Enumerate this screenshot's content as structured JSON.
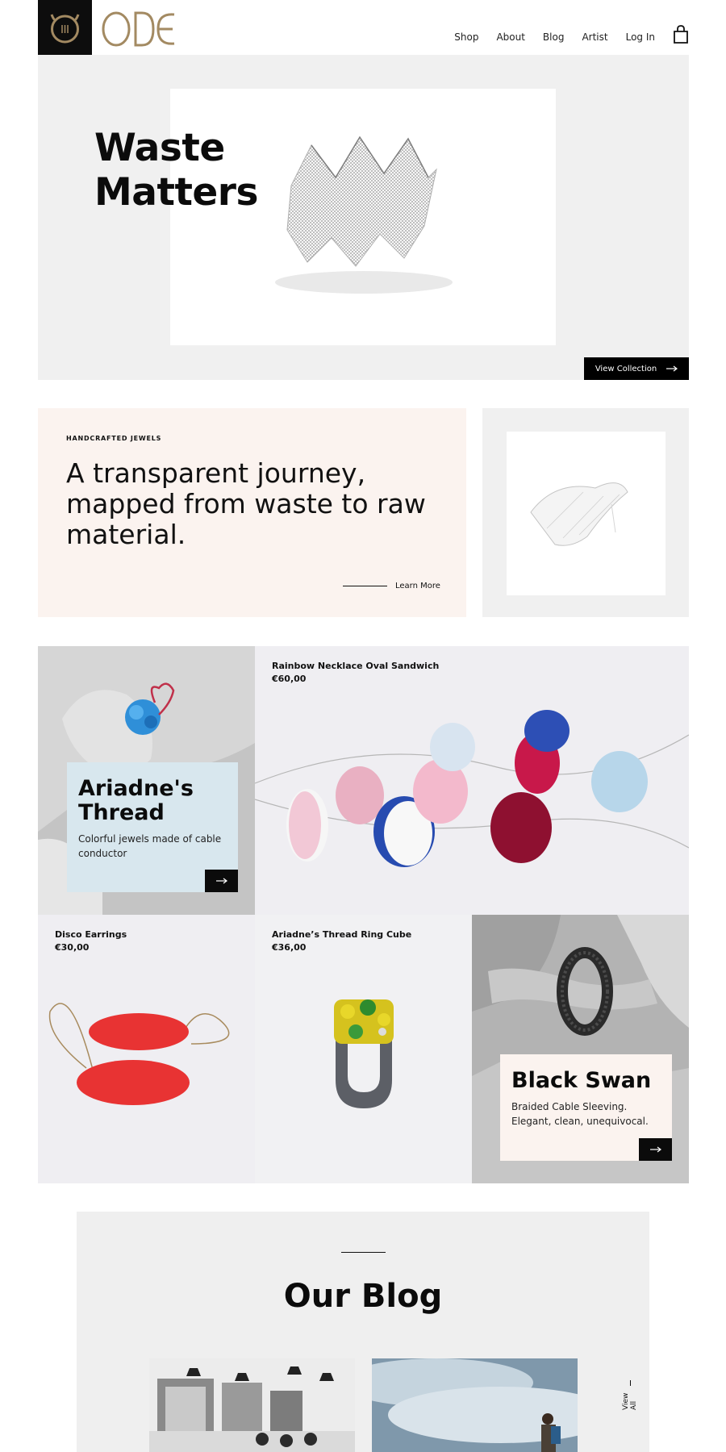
{
  "brand": {
    "name": "ODE",
    "accent": "#a38a62",
    "logo_bg": "#0d0d0d"
  },
  "nav": {
    "items": [
      {
        "label": "Shop"
      },
      {
        "label": "About"
      },
      {
        "label": "Blog"
      },
      {
        "label": "Artist"
      },
      {
        "label": "Log In"
      }
    ],
    "cart_icon": "shopping-bag-icon"
  },
  "hero": {
    "title_line1": "Waste",
    "title_line2": "Matters",
    "button_label": "View Collection",
    "button_icon": "arrow-right-icon"
  },
  "intro": {
    "eyebrow": "HANDCRAFTED JEWELS",
    "headline": "A transparent journey, mapped from waste to raw material.",
    "link_label": "Learn More"
  },
  "products": [
    {
      "name": "Rainbow Necklace Oval Sandwich",
      "price": "€60,00"
    },
    {
      "name": "Disco Earrings",
      "price": "€30,00"
    },
    {
      "name": "Ariadne’s Thread Ring Cube",
      "price": "€36,00"
    }
  ],
  "promos": [
    {
      "title": "Ariadne's Thread",
      "text": "Colorful jewels made of cable conductor",
      "bg": "#d8e7ee"
    },
    {
      "title": "Black Swan",
      "text": "Braided Cable Sleeving. Elegant, clean, unequivocal.",
      "bg": "#fbf3ef"
    }
  ],
  "blog": {
    "title": "Our Blog",
    "view_all": "View All"
  }
}
